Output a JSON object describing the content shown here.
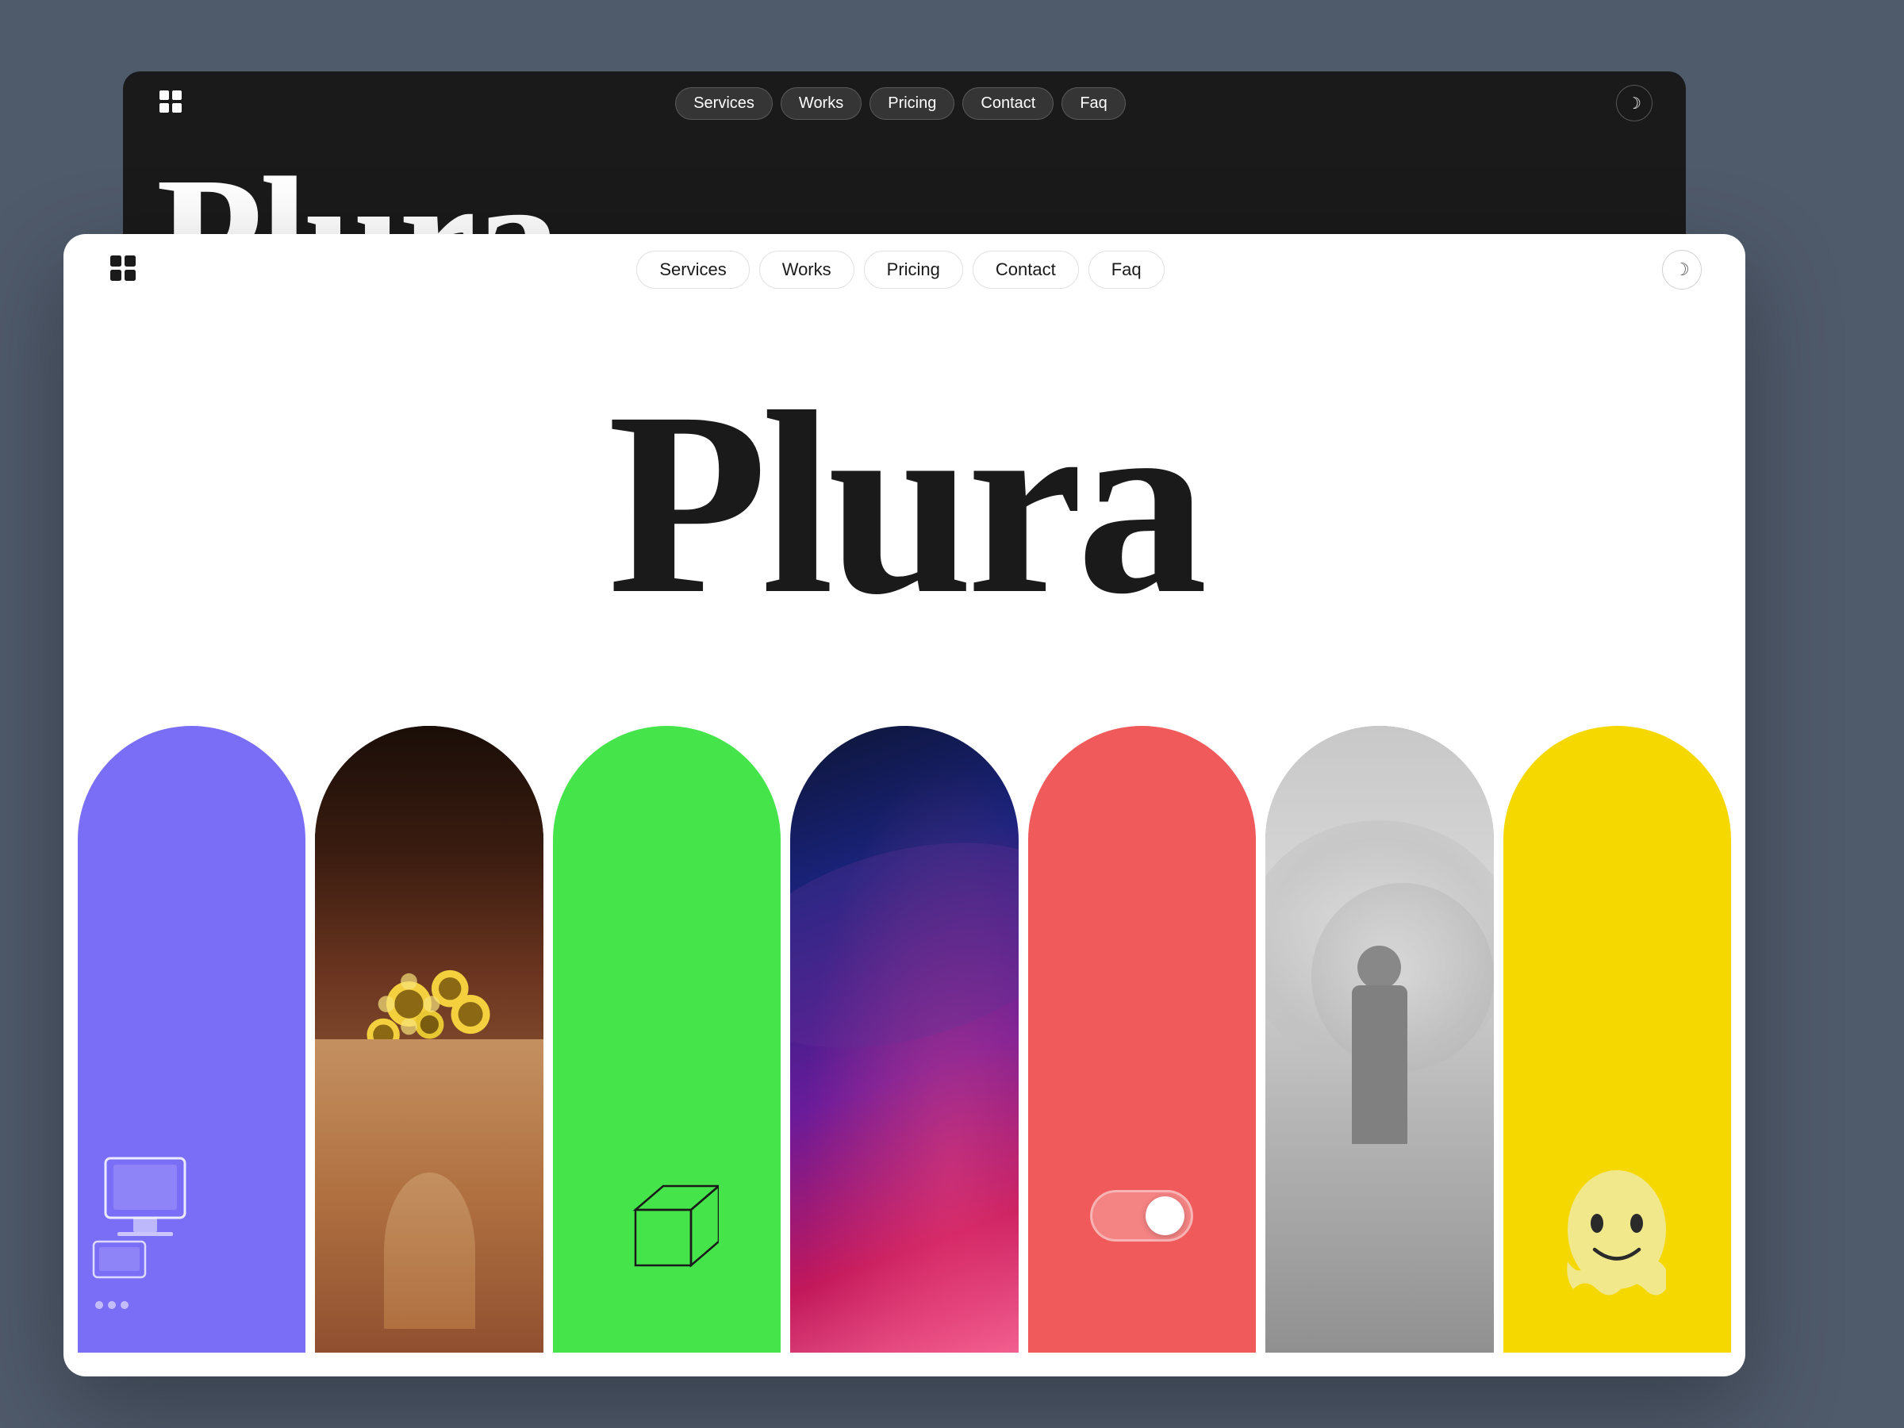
{
  "background": {
    "color": "#4f5a6b"
  },
  "darkCard": {
    "background": "#1a1a1a",
    "logo": "◈",
    "nav": {
      "items": [
        {
          "label": "Services",
          "id": "services"
        },
        {
          "label": "Works",
          "id": "works"
        },
        {
          "label": "Pricing",
          "id": "pricing"
        },
        {
          "label": "Contact",
          "id": "contact"
        },
        {
          "label": "Faq",
          "id": "faq"
        }
      ]
    },
    "hero": {
      "title": "Plura"
    },
    "moonIcon": "☾"
  },
  "whiteCard": {
    "background": "#ffffff",
    "logo": "◈",
    "nav": {
      "items": [
        {
          "label": "Services",
          "id": "services"
        },
        {
          "label": "Works",
          "id": "works"
        },
        {
          "label": "Pricing",
          "id": "pricing"
        },
        {
          "label": "Contact",
          "id": "contact"
        },
        {
          "label": "Faq",
          "id": "faq"
        }
      ]
    },
    "hero": {
      "title": "Plura"
    },
    "moonIcon": "☾",
    "archPanels": [
      {
        "color": "#7b6ef6",
        "type": "purple",
        "id": "arch-purple"
      },
      {
        "color": "#2a1810",
        "type": "photo-flower",
        "id": "arch-flower"
      },
      {
        "color": "#44e44a",
        "type": "green",
        "id": "arch-green"
      },
      {
        "color": "#1a2040",
        "type": "dark-gradient",
        "id": "arch-dark"
      },
      {
        "color": "#f05a5a",
        "type": "coral",
        "id": "arch-coral"
      },
      {
        "color": "#888888",
        "type": "photo-bw",
        "id": "arch-bw"
      },
      {
        "color": "#f5d800",
        "type": "yellow",
        "id": "arch-yellow"
      }
    ]
  }
}
